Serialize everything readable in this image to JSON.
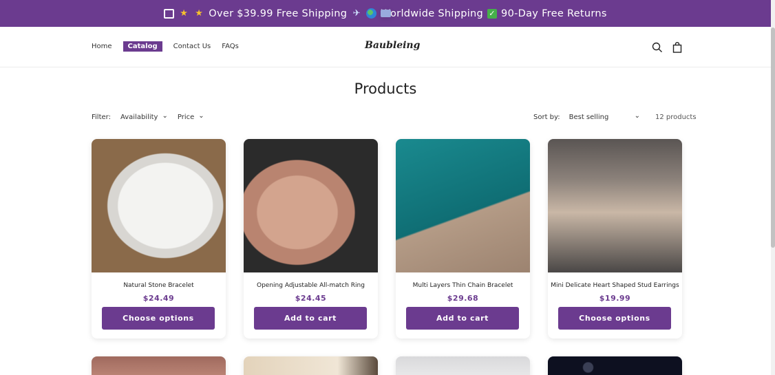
{
  "announcement": {
    "text": "Over $39.99 Free Shipping",
    "text2": "Worldwide Shipping",
    "text3": "90-Day Free Returns",
    "icons": [
      "gift-box-icon",
      "star-icon",
      "star-icon",
      "card-icon",
      "airplane-icon",
      "globe-icon",
      "checkmark-icon"
    ]
  },
  "header": {
    "logo": "Baubleing",
    "nav": [
      "Home",
      "Catalog",
      "Contact Us",
      "FAQs"
    ],
    "active_nav": "Catalog"
  },
  "page": {
    "title": "Products"
  },
  "filters": {
    "label": "Filter:",
    "availability": "Availability",
    "price": "Price",
    "sort_label": "Sort by:",
    "sort_value": "Best selling",
    "count": "12 products"
  },
  "products": [
    {
      "name": "Natural Stone Bracelet",
      "price": "$24.49",
      "button": "Choose options"
    },
    {
      "name": "Opening Adjustable All-match Ring",
      "price": "$24.45",
      "button": "Add to cart"
    },
    {
      "name": "Multi Layers Thin Chain Bracelet",
      "price": "$29.68",
      "button": "Add to cart"
    },
    {
      "name": "Mini Delicate Heart Shaped Stud Earrings",
      "price": "$19.99",
      "button": "Choose options"
    }
  ],
  "colors": {
    "accent": "#6b3b8f"
  }
}
